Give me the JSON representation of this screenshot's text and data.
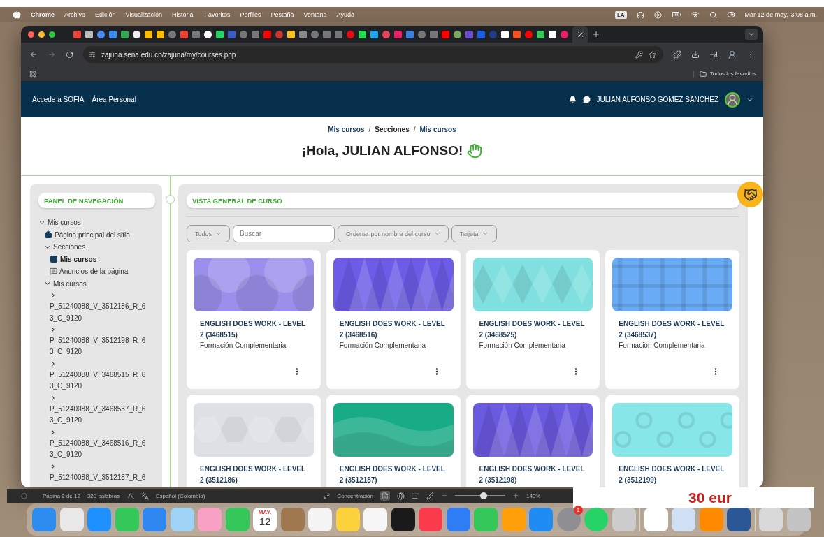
{
  "menu_bar": {
    "app": "Chrome",
    "items": [
      "Archivo",
      "Edición",
      "Visualización",
      "Historial",
      "Favoritos",
      "Perfiles",
      "Pestaña",
      "Ventana",
      "Ayuda"
    ],
    "input_source": "LA",
    "date": "Mar 12 de may.",
    "time": "3:08 a.m."
  },
  "browser": {
    "url": "zajuna.sena.edu.co/zajuna/my/courses.php",
    "bookmarks_folder": "Todos los favoritos"
  },
  "site_nav": {
    "links": [
      "Accede a SOFIA",
      "Área Personal"
    ],
    "user_name": "JULIAN ALFONSO GOMEZ SANCHEZ"
  },
  "breadcrumb": {
    "separator": "/",
    "items": [
      {
        "label": "Mis cursos",
        "link": true
      },
      {
        "label": "Secciones",
        "link": false
      },
      {
        "label": "Mis cursos",
        "link": true
      }
    ]
  },
  "greeting": "¡Hola, JULIAN ALFONSO!",
  "nav_panel": {
    "title": "PANEL DE NAVEGACIÓN",
    "tree": [
      {
        "label": "Mis cursos",
        "kind": "folder",
        "expanded": true,
        "selected": false,
        "children": [
          {
            "label": "Página principal del sitio",
            "kind": "home",
            "selected": false
          },
          {
            "label": "Secciones",
            "kind": "folder",
            "expanded": true,
            "selected": false,
            "children": [
              {
                "label": "Mis cursos",
                "kind": "page",
                "selected": true
              },
              {
                "label": "Anuncios de la página",
                "kind": "forum",
                "selected": false
              }
            ]
          },
          {
            "label": "Mis cursos",
            "kind": "folder",
            "expanded": true,
            "selected": false,
            "children": [
              {
                "label": "P_51240088_V_3512186_R_63_C_9120",
                "kind": "course",
                "expanded": false,
                "selected": false
              },
              {
                "label": "P_51240088_V_3512198_R_63_C_9120",
                "kind": "course",
                "expanded": false,
                "selected": false
              },
              {
                "label": "P_51240088_V_3468515_R_63_C_9120",
                "kind": "course",
                "expanded": false,
                "selected": false
              },
              {
                "label": "P_51240088_V_3468537_R_63_C_9120",
                "kind": "course",
                "expanded": false,
                "selected": false
              },
              {
                "label": "P_51240088_V_3468516_R_63_C_9120",
                "kind": "course",
                "expanded": false,
                "selected": false
              },
              {
                "label": "P_51240088_V_3512187_R_6",
                "kind": "course",
                "expanded": false,
                "selected": false
              }
            ]
          }
        ]
      }
    ]
  },
  "course_overview": {
    "title": "VISTA GENERAL DE CURSO",
    "filters": [
      {
        "kind": "select",
        "label": "Todos"
      },
      {
        "kind": "search",
        "placeholder": "Buscar"
      },
      {
        "kind": "select",
        "label": "Ordenar por nombre del curso"
      },
      {
        "kind": "select",
        "label": "Tarjeta"
      }
    ],
    "courses": [
      {
        "title": "ENGLISH DOES WORK - LEVEL 2 (3468515)",
        "category": "Formación Complementaria",
        "kind": "circles",
        "color": "#9a90ec"
      },
      {
        "title": "ENGLISH DOES WORK - LEVEL 2 (3468516)",
        "category": "Formación Complementaria",
        "kind": "triangles",
        "color": "#6c5ce7"
      },
      {
        "title": "ENGLISH DOES WORK - LEVEL 2 (3468525)",
        "category": "Formación Complementaria",
        "kind": "diamonds",
        "color": "#7fe0df"
      },
      {
        "title": "ENGLISH DOES WORK - LEVEL 2 (3468537)",
        "category": "Formación Complementaria",
        "kind": "plaid",
        "color": "#6aabf5"
      },
      {
        "title": "ENGLISH DOES WORK - LEVEL 2 (3512186)",
        "kind": "hexagons",
        "color": "#dde1e5"
      },
      {
        "title": "ENGLISH DOES WORK - LEVEL 2 (3512187)",
        "kind": "waves",
        "color": "#17ab86"
      },
      {
        "title": "ENGLISH DOES WORK - LEVEL 2 (3512198)",
        "kind": "triangles",
        "color": "#6a5ae0"
      },
      {
        "title": "ENGLISH DOES WORK - LEVEL 2 (3512199)",
        "kind": "rings",
        "color": "#86e6e8"
      }
    ]
  },
  "word_status": {
    "page": "Página 2 de 12",
    "words": "329 palabras",
    "language": "Español (Colombia)",
    "focus": "Concentración",
    "zoom": "140%",
    "zoom_slider": {
      "level": 0.57
    }
  },
  "background_window_text": "30 eur",
  "dock": {
    "calendar_month": "MAY.",
    "calendar_day": "12",
    "badge": "1"
  }
}
